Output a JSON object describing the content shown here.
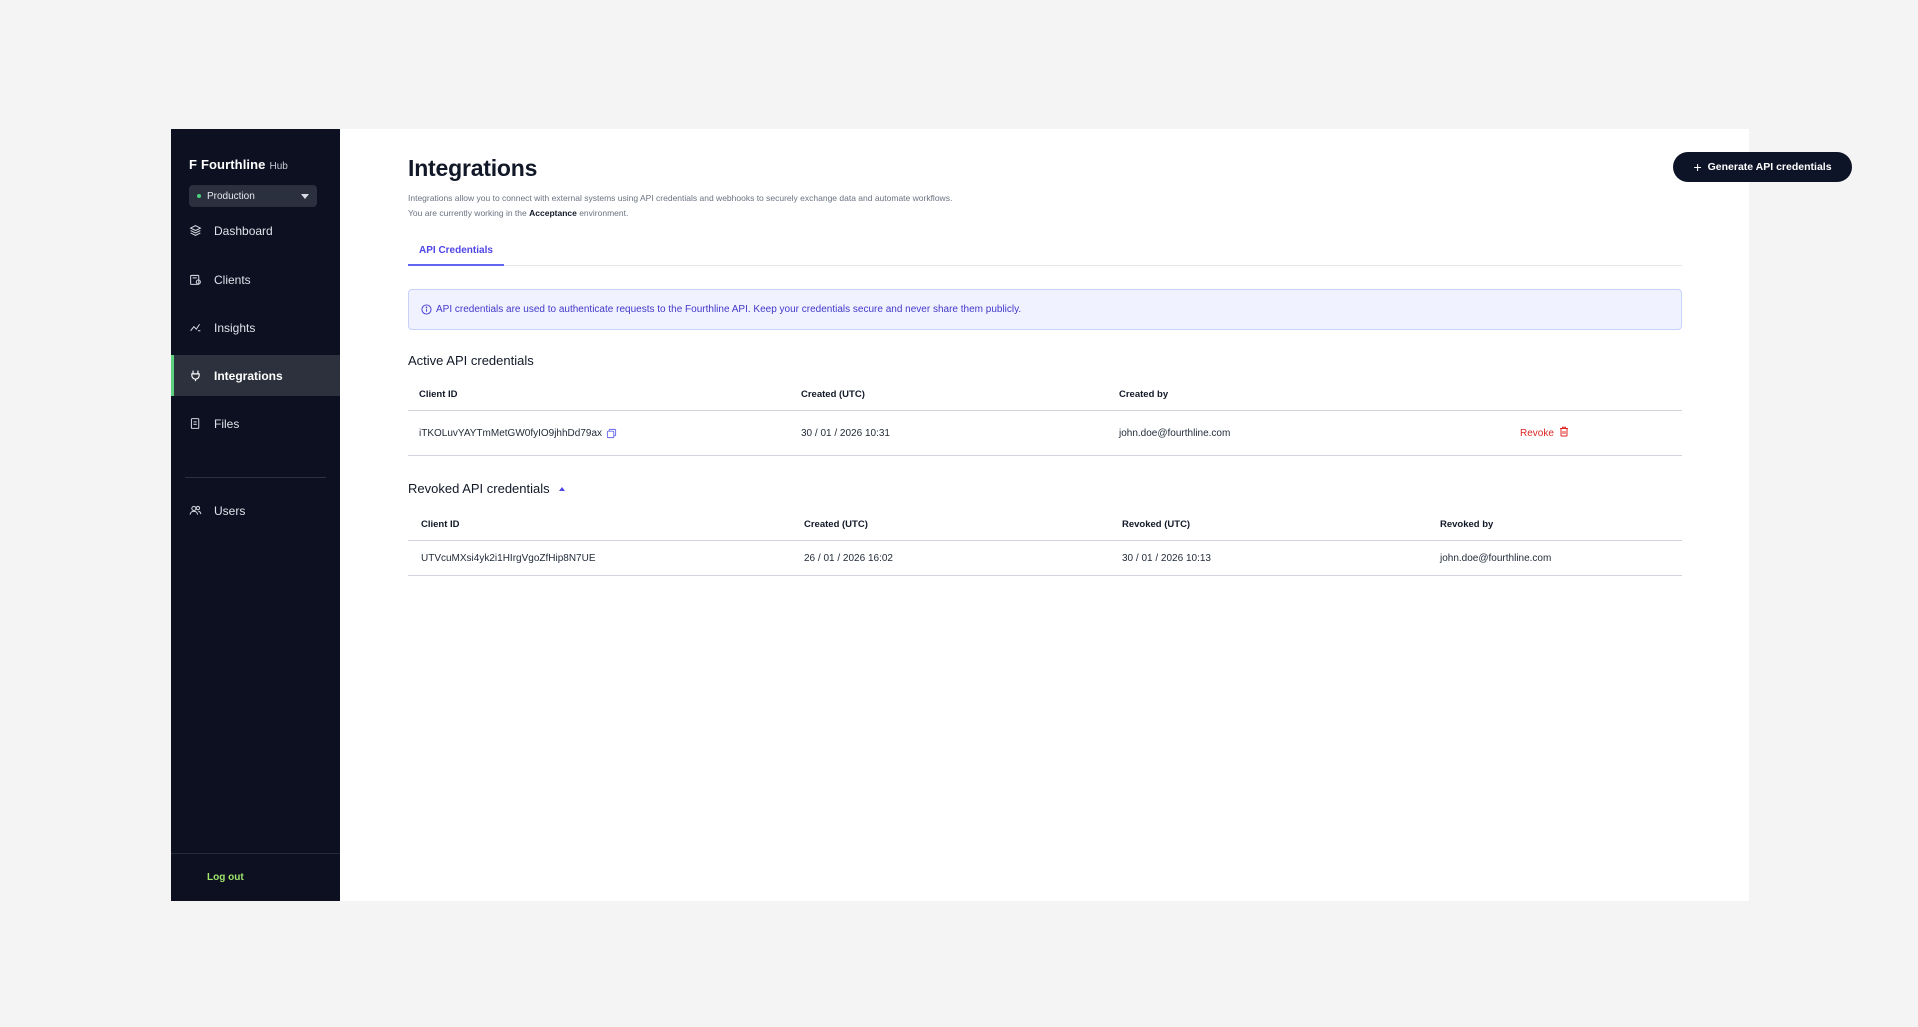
{
  "sidebar": {
    "brand": {
      "logo_glyph": "F",
      "name": "Fourthline",
      "sub": "Hub"
    },
    "environment": {
      "label": "Production",
      "status_color": "#49d17e"
    },
    "nav": [
      {
        "label": "Dashboard",
        "icon": "layers-icon",
        "active": false
      },
      {
        "label": "Clients",
        "icon": "clients-icon",
        "active": false
      },
      {
        "label": "Insights",
        "icon": "insights-icon",
        "active": false
      },
      {
        "label": "Integrations",
        "icon": "plug-icon",
        "active": true
      },
      {
        "label": "Files",
        "icon": "files-icon",
        "active": false
      }
    ],
    "secondary_nav": [
      {
        "label": "Users",
        "icon": "users-icon",
        "active": false
      }
    ],
    "logout_label": "Log out"
  },
  "header": {
    "title": "Integrations",
    "description_line1": "Integrations allow you to connect with external systems using API credentials and webhooks to securely exchange data and automate workflows.",
    "description_line2_prefix": "You are currently working in the ",
    "description_line2_env": "Acceptance",
    "description_line2_suffix": " environment.",
    "generate_button_label": "Generate API credentials"
  },
  "tabs": [
    {
      "label": "API Credentials",
      "active": true
    }
  ],
  "info_banner": "API credentials are used to authenticate requests to the Fourthline API. Keep your credentials secure and never share them publicly.",
  "active_credentials": {
    "title": "Active API credentials",
    "columns": [
      "Client ID",
      "Created (UTC)",
      "Created by"
    ],
    "rows": [
      {
        "client_id": "iTKOLuvYAYTmMetGW0fyIO9jhhDd79ax",
        "created": "30 / 01 / 2026 10:31",
        "created_by": "john.doe@fourthline.com",
        "action_label": "Revoke"
      }
    ]
  },
  "revoked_credentials": {
    "title": "Revoked API credentials",
    "columns": [
      "Client ID",
      "Created (UTC)",
      "Revoked (UTC)",
      "Revoked by"
    ],
    "rows": [
      {
        "client_id": "UTVcuMXsi4yk2i1HIrgVgoZfHip8N7UE",
        "created": "26 / 01 / 2026 16:02",
        "revoked": "30 / 01 / 2026 10:13",
        "revoked_by": "john.doe@fourthline.com"
      }
    ]
  },
  "colors": {
    "sidebar_bg": "#0c1020",
    "accent": "#4f46e5",
    "active_indicator": "#5dd07f",
    "danger": "#dc2626",
    "logout": "#9fe66b"
  }
}
